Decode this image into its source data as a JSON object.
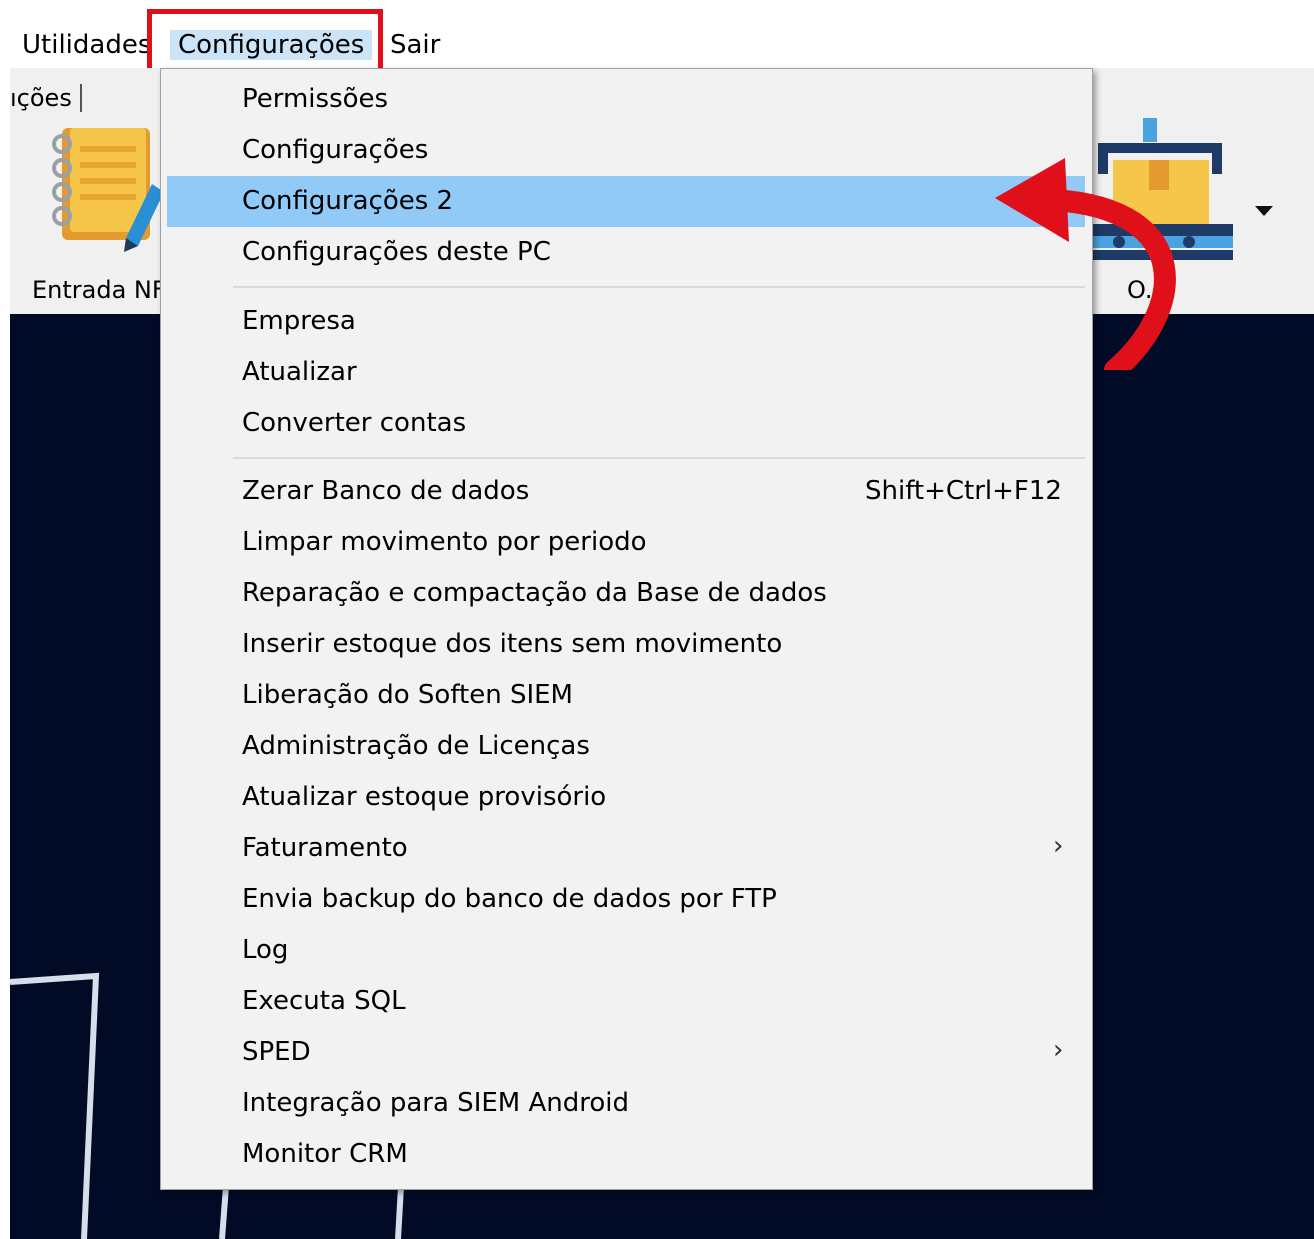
{
  "menubar": {
    "items": [
      {
        "label": "Utilidades"
      },
      {
        "label": "Configurações"
      },
      {
        "label": "Sair"
      }
    ]
  },
  "toolbar": {
    "tab_label": "ıções",
    "buttons": [
      {
        "label": "Entrada NF",
        "icon": "notebook-pencil-icon"
      },
      {
        "label": "O.",
        "icon": "conveyor-box-icon"
      }
    ],
    "dropdown_icon": "triangle-down-icon"
  },
  "menu": {
    "items": [
      {
        "label": "Permissões"
      },
      {
        "label": "Configurações"
      },
      {
        "label": "Configurações 2",
        "selected": true
      },
      {
        "label": "Configurações deste PC"
      },
      {
        "label": "Empresa"
      },
      {
        "label": "Atualizar"
      },
      {
        "label": "Converter contas"
      },
      {
        "label": "Zerar Banco de dados",
        "shortcut": "Shift+Ctrl+F12"
      },
      {
        "label": "Limpar movimento por periodo"
      },
      {
        "label": "Reparação e compactação da Base de dados"
      },
      {
        "label": "Inserir estoque dos itens sem movimento"
      },
      {
        "label": "Liberação do Soften SIEM"
      },
      {
        "label": "Administração de Licenças"
      },
      {
        "label": "Atualizar estoque provisório"
      },
      {
        "label": "Faturamento",
        "submenu": true
      },
      {
        "label": "Envia backup do banco de dados por FTP"
      },
      {
        "label": "Log"
      },
      {
        "label": "Executa SQL"
      },
      {
        "label": "SPED",
        "submenu": true
      },
      {
        "label": "Integração para SIEM Android"
      },
      {
        "label": "Monitor CRM"
      }
    ],
    "submenu_arrow": "›",
    "highlight_color": "#91c9f7",
    "annotation_color": "#e0101a"
  }
}
